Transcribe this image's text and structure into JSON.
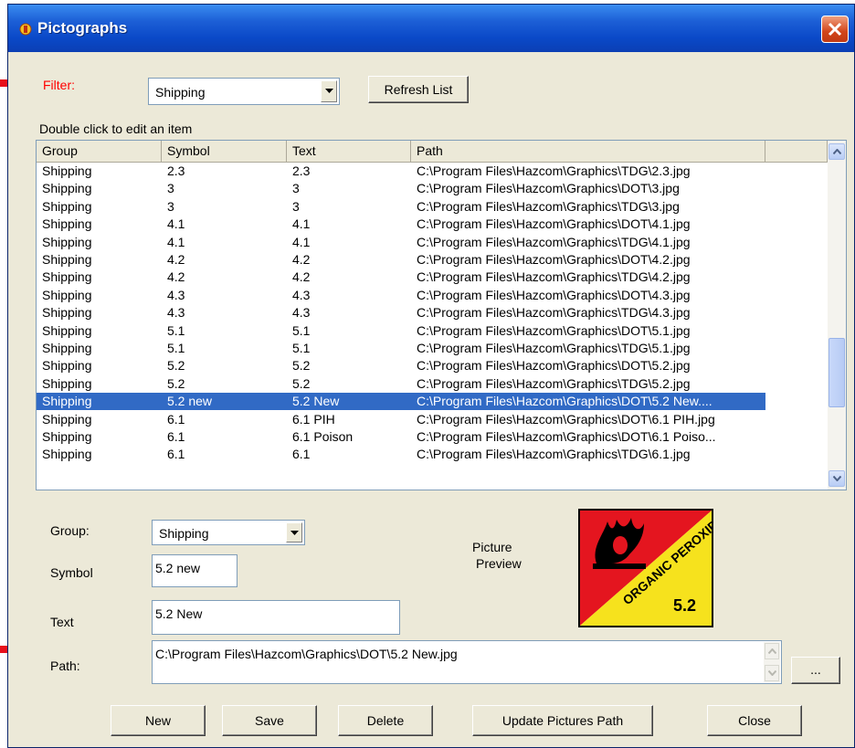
{
  "window": {
    "title": "Pictographs"
  },
  "filter": {
    "label": "Filter:",
    "value": "Shipping",
    "refresh_label": "Refresh List"
  },
  "list": {
    "hint": "Double click to edit an item",
    "columns": [
      "Group",
      "Symbol",
      "Text",
      "Path"
    ],
    "rows": [
      [
        "Shipping",
        "2.3",
        "2.3",
        "C:\\Program Files\\Hazcom\\Graphics\\TDG\\2.3.jpg"
      ],
      [
        "Shipping",
        "3",
        "3",
        "C:\\Program Files\\Hazcom\\Graphics\\DOT\\3.jpg"
      ],
      [
        "Shipping",
        "3",
        "3",
        "C:\\Program Files\\Hazcom\\Graphics\\TDG\\3.jpg"
      ],
      [
        "Shipping",
        "4.1",
        "4.1",
        "C:\\Program Files\\Hazcom\\Graphics\\DOT\\4.1.jpg"
      ],
      [
        "Shipping",
        "4.1",
        "4.1",
        "C:\\Program Files\\Hazcom\\Graphics\\TDG\\4.1.jpg"
      ],
      [
        "Shipping",
        "4.2",
        "4.2",
        "C:\\Program Files\\Hazcom\\Graphics\\DOT\\4.2.jpg"
      ],
      [
        "Shipping",
        "4.2",
        "4.2",
        "C:\\Program Files\\Hazcom\\Graphics\\TDG\\4.2.jpg"
      ],
      [
        "Shipping",
        "4.3",
        "4.3",
        "C:\\Program Files\\Hazcom\\Graphics\\DOT\\4.3.jpg"
      ],
      [
        "Shipping",
        "4.3",
        "4.3",
        "C:\\Program Files\\Hazcom\\Graphics\\TDG\\4.3.jpg"
      ],
      [
        "Shipping",
        "5.1",
        "5.1",
        "C:\\Program Files\\Hazcom\\Graphics\\DOT\\5.1.jpg"
      ],
      [
        "Shipping",
        "5.1",
        "5.1",
        "C:\\Program Files\\Hazcom\\Graphics\\TDG\\5.1.jpg"
      ],
      [
        "Shipping",
        "5.2",
        "5.2",
        "C:\\Program Files\\Hazcom\\Graphics\\DOT\\5.2.jpg"
      ],
      [
        "Shipping",
        "5.2",
        "5.2",
        "C:\\Program Files\\Hazcom\\Graphics\\TDG\\5.2.jpg"
      ],
      [
        "Shipping",
        "5.2 new",
        "5.2 New",
        "C:\\Program Files\\Hazcom\\Graphics\\DOT\\5.2 New...."
      ],
      [
        "Shipping",
        "6.1",
        "6.1 PIH",
        "C:\\Program Files\\Hazcom\\Graphics\\DOT\\6.1 PIH.jpg"
      ],
      [
        "Shipping",
        "6.1",
        "6.1 Poison",
        "C:\\Program Files\\Hazcom\\Graphics\\DOT\\6.1 Poiso..."
      ],
      [
        "Shipping",
        "6.1",
        "6.1",
        "C:\\Program Files\\Hazcom\\Graphics\\TDG\\6.1.jpg"
      ]
    ],
    "selected_index": 13
  },
  "form": {
    "group_label": "Group:",
    "group_value": "Shipping",
    "symbol_label": "Symbol",
    "symbol_value": "5.2 new",
    "text_label": "Text",
    "text_value": "5.2 New",
    "path_label": "Path:",
    "path_value": "C:\\Program Files\\Hazcom\\Graphics\\DOT\\5.2 New.jpg",
    "browse_label": "...",
    "preview_label_1": "Picture",
    "preview_label_2": "Preview",
    "placard": {
      "text": "ORGANIC PEROXIDE",
      "number": "5.2"
    }
  },
  "buttons": {
    "new": "New",
    "save": "Save",
    "delete": "Delete",
    "update_path": "Update Pictures Path",
    "close": "Close"
  },
  "colors": {
    "annotation_arrow": "#e8101a",
    "filter_label": "#ff0000",
    "selection": "#316ac5"
  }
}
